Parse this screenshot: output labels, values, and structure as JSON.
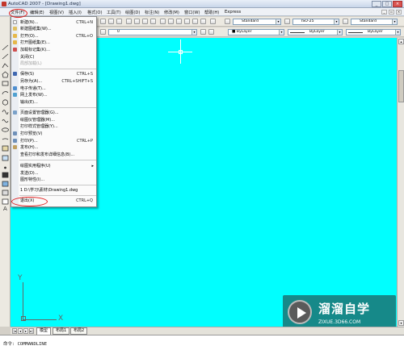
{
  "window": {
    "title": "AutoCAD 2007 - [Drawing1.dwg]",
    "minimize_label": "_",
    "maximize_label": "□",
    "close_label": "×"
  },
  "menubar": {
    "items": [
      "文件(F)",
      "编辑(E)",
      "视图(V)",
      "插入(I)",
      "格式(O)",
      "工具(T)",
      "绘图(D)",
      "标注(N)",
      "修改(M)",
      "窗口(W)",
      "帮助(H)",
      "Express"
    ],
    "mdi_minimize": "_",
    "mdi_restore": "▫",
    "mdi_close": "×"
  },
  "toolbar": {
    "text_style": "Standard",
    "dim_style": "ISO-25",
    "table_style": "Standard",
    "layer": "0",
    "color": "■ ByLayer",
    "linetype": "ByLayer",
    "lineweight": "ByLayer"
  },
  "file_menu": {
    "items": [
      {
        "label": "新建(N)...",
        "shortcut": "CTRL+N",
        "icon_color": "#f5f5f5",
        "disabled": false
      },
      {
        "label": "新建图纸集(W)...",
        "shortcut": "",
        "icon_color": "#e0c060",
        "disabled": false
      },
      {
        "label": "打开(O)...",
        "shortcut": "CTRL+O",
        "icon_color": "#e6b84a",
        "disabled": false
      },
      {
        "label": "打开图纸集(E)...",
        "shortcut": "",
        "icon_color": "#e6b84a",
        "disabled": false
      },
      {
        "label": "加载标记集(K)...",
        "shortcut": "",
        "icon_color": "#d05050",
        "disabled": false
      },
      {
        "label": "关闭(C)",
        "shortcut": "",
        "icon_color": "",
        "disabled": false
      },
      {
        "label": "局部加载(L)",
        "shortcut": "",
        "icon_color": "",
        "disabled": true
      },
      {
        "label": "保存(S)",
        "shortcut": "CTRL+S",
        "icon_color": "#3f67b0",
        "disabled": false
      },
      {
        "label": "另存为(A)...",
        "shortcut": "CTRL+SHIFT+S",
        "icon_color": "",
        "disabled": false
      },
      {
        "label": "电子传递(T)...",
        "shortcut": "",
        "icon_color": "#4f8fd0",
        "disabled": false
      },
      {
        "label": "网上发布(W)...",
        "shortcut": "",
        "icon_color": "#4fa0d0",
        "disabled": false
      },
      {
        "label": "输出(E)...",
        "shortcut": "",
        "icon_color": "",
        "disabled": false
      },
      {
        "label": "页面设置管理器(G)...",
        "shortcut": "",
        "icon_color": "#7aa0c8",
        "disabled": false
      },
      {
        "label": "绘图仪管理器(M)...",
        "shortcut": "",
        "icon_color": "",
        "disabled": false
      },
      {
        "label": "打印样式管理器(Y)...",
        "shortcut": "",
        "icon_color": "",
        "disabled": false
      },
      {
        "label": "打印预览(V)",
        "shortcut": "",
        "icon_color": "#6f90b8",
        "disabled": false
      },
      {
        "label": "打印(P)...",
        "shortcut": "CTRL+P",
        "icon_color": "#6f90b8",
        "disabled": false
      },
      {
        "label": "发布(H)...",
        "shortcut": "",
        "icon_color": "#c0a060",
        "disabled": false
      },
      {
        "label": "查看打印和发布详细信息(B)...",
        "shortcut": "",
        "icon_color": "",
        "disabled": false
      },
      {
        "label": "绘图实用程序(U)",
        "shortcut": "",
        "icon_color": "",
        "disabled": false,
        "submenu": true
      },
      {
        "label": "发送(D)...",
        "shortcut": "",
        "icon_color": "",
        "disabled": false
      },
      {
        "label": "图形特性(I)...",
        "shortcut": "",
        "icon_color": "",
        "disabled": false
      },
      {
        "label": "1 D:\\学习\\素材\\Drawing1.dwg",
        "shortcut": "",
        "icon_color": "",
        "disabled": false
      },
      {
        "label": "退出(X)",
        "shortcut": "CTRL+Q",
        "icon_color": "",
        "disabled": false
      }
    ],
    "submenu_arrow": "▸"
  },
  "tabs": {
    "nav": [
      "|◂",
      "◂",
      "▸",
      "▸|"
    ],
    "model": "模型",
    "layout1": "布局1",
    "layout2": "布局2"
  },
  "canvas": {
    "background": "#00ffff",
    "ucs_x": "X",
    "ucs_y": "Y"
  },
  "command_line": {
    "text": "命令: COMMANDLINE"
  },
  "watermark": {
    "title": "溜溜自学",
    "url": "ZIXUE.3D66.COM"
  }
}
